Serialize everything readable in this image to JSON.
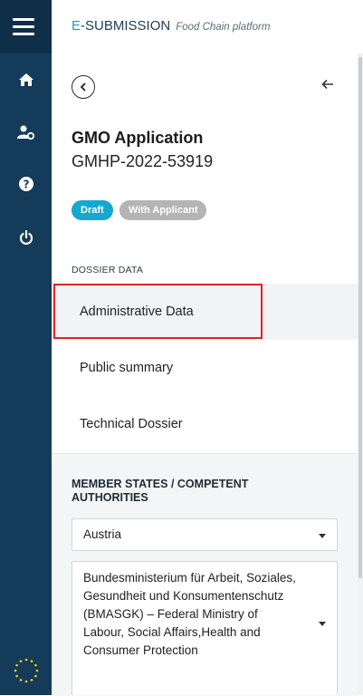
{
  "header": {
    "brand_prefix": "E",
    "brand_rest": "-SUBMISSION",
    "brand_tagline": "Food Chain platform"
  },
  "rail": {
    "icons": [
      "menu-icon",
      "home-icon",
      "user-settings-icon",
      "help-icon",
      "power-icon",
      "eu-stars-icon"
    ]
  },
  "application": {
    "title": "GMO Application",
    "id": "GMHP-2022-53919",
    "badges": [
      "Draft",
      "With Applicant"
    ]
  },
  "dossier": {
    "section_label": "DOSSIER DATA",
    "items": [
      "Administrative Data",
      "Public summary",
      "Technical Dossier"
    ],
    "active_index": 0
  },
  "member_states": {
    "title": "MEMBER STATES / COMPETENT AUTHORITIES",
    "country": "Austria",
    "authority": "Bundesministerium für Arbeit, Soziales, Gesundheit und Konsumentenschutz (BMASGK) – Federal Ministry of Labour, Social Affairs,Health and Consumer Protection"
  },
  "colors": {
    "rail": "#153b5a",
    "accent": "#1a9bd7",
    "draft_badge": "#16a7cf",
    "applicant_badge": "#b4b4b4",
    "highlight": "#e02424"
  }
}
